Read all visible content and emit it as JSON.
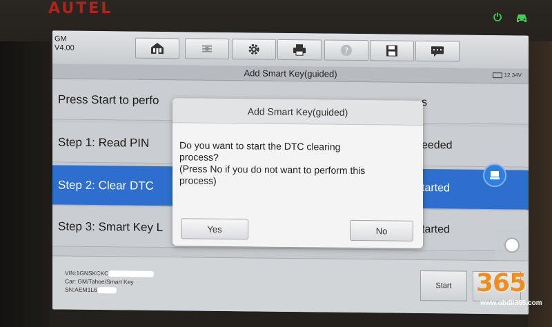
{
  "device": {
    "brand": "AUTEL"
  },
  "header": {
    "make": "GM",
    "version": "V4.00"
  },
  "toolbar": {
    "icons": [
      "home-icon",
      "vci-icon",
      "gear-icon",
      "printer-icon",
      "help-icon",
      "save-icon",
      "message-icon"
    ]
  },
  "titlebar": {
    "title": "Add Smart Key(guided)",
    "battery": "12.34V"
  },
  "steps": [
    {
      "label": "Press Start to perfo",
      "status": "s"
    },
    {
      "label": "Step 1: Read PIN",
      "status": "eeded"
    },
    {
      "label": "Step 2: Clear DTC",
      "status": "tarted"
    },
    {
      "label": "Step 3: Smart Key L",
      "status": "tarted"
    }
  ],
  "footer": {
    "vin_label": "VIN:1GNSKCKC",
    "car_label": "Car: GM/Tahoe/Smart Key",
    "sn_label": "SN:AEM1L6",
    "start_label": "Start"
  },
  "dialog": {
    "title": "Add Smart Key(guided)",
    "line1": "Do you want to start the DTC clearing",
    "line2": "process?",
    "line3": "(Press No if you do not want to perform this",
    "line4": "process)",
    "yes_label": "Yes",
    "no_label": "No"
  },
  "watermark": {
    "number": "365",
    "url": "www.obdii365.com"
  }
}
